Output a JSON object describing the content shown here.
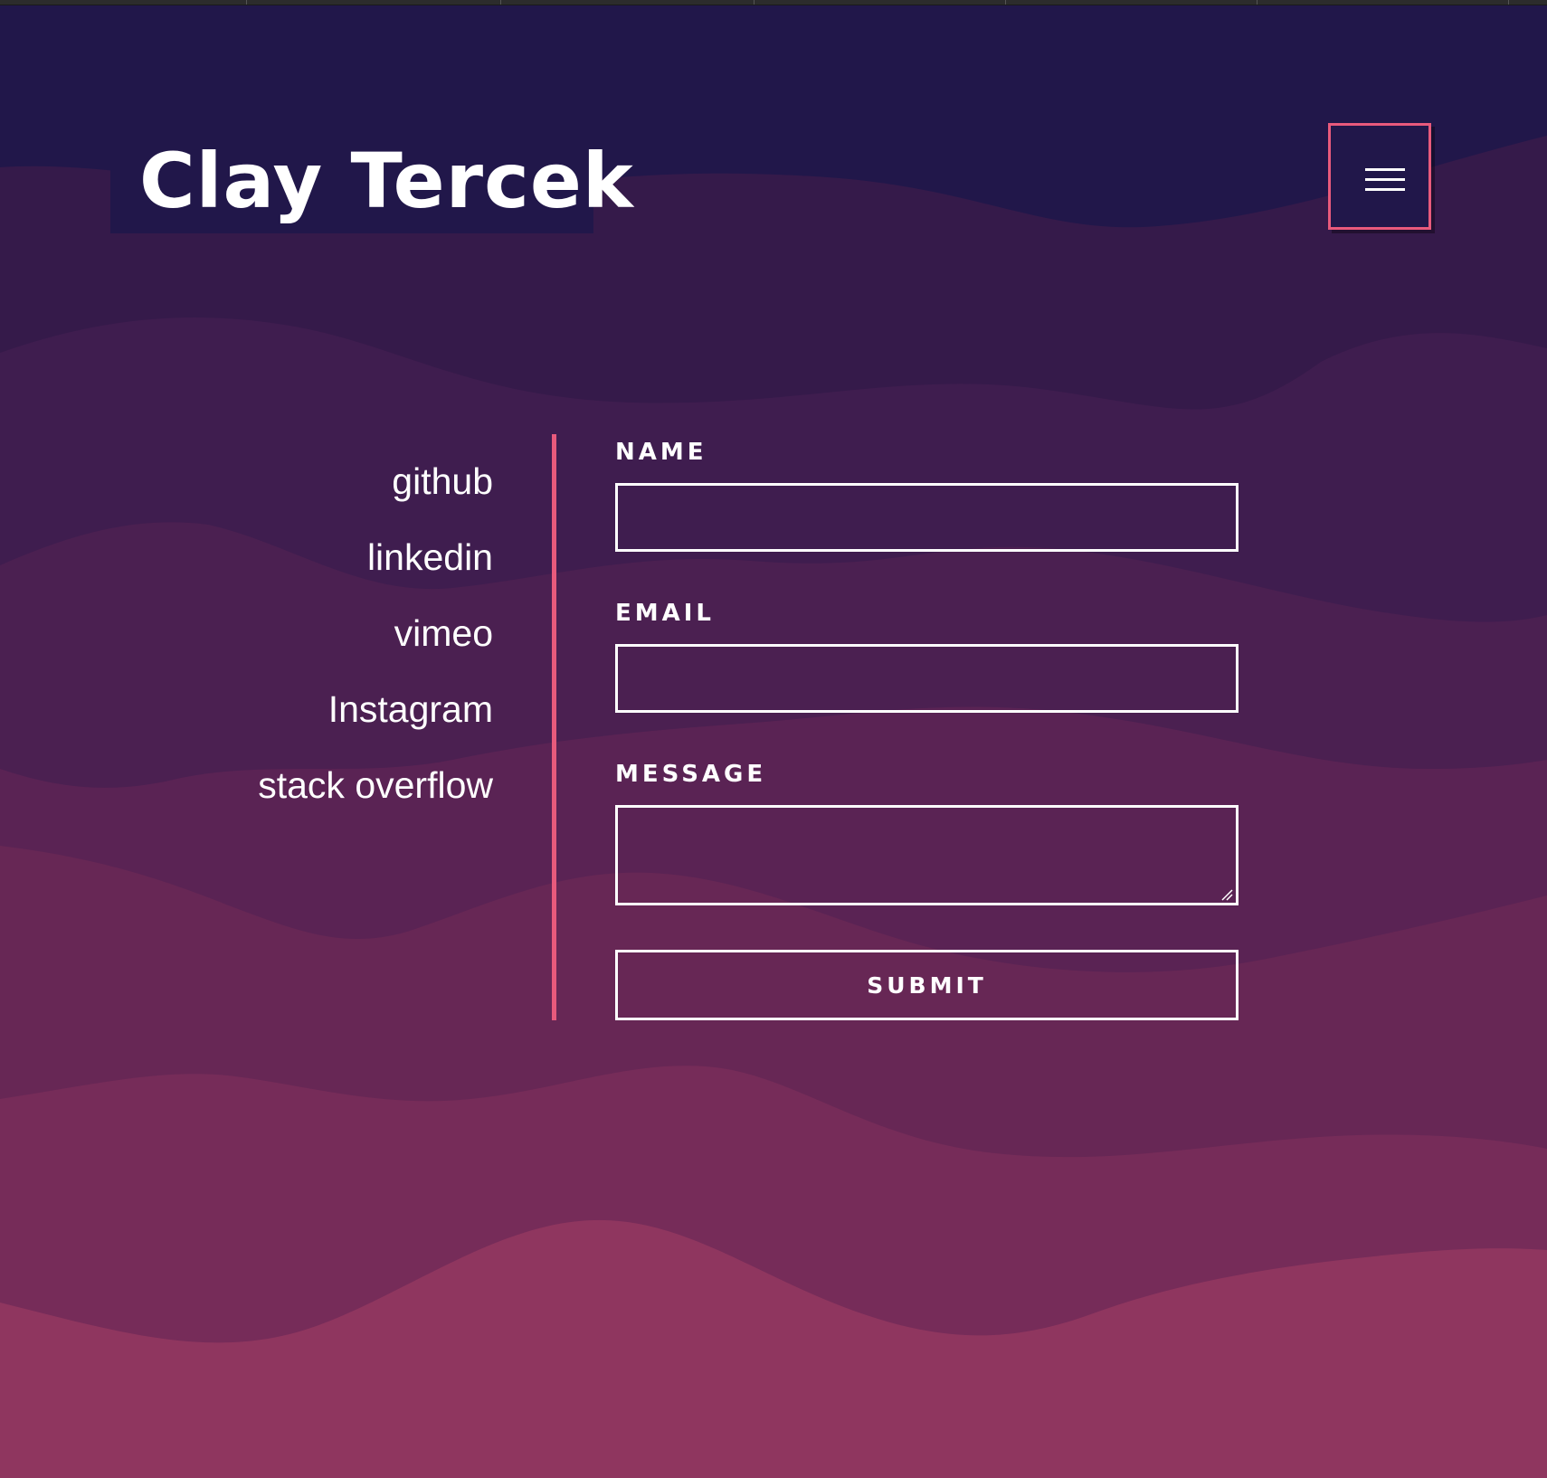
{
  "header": {
    "brand": "Clay Tercek",
    "menu_icon": "hamburger-menu-icon"
  },
  "social": {
    "links": [
      "github",
      "linkedin",
      "vimeo",
      "Instagram",
      "stack overflow"
    ]
  },
  "contact_form": {
    "name_label": "NAME",
    "name_value": "",
    "email_label": "EMAIL",
    "email_value": "",
    "message_label": "MESSAGE",
    "message_value": "",
    "submit_label": "SUBMIT"
  },
  "colors": {
    "background_top": "#21174a",
    "background_bottom": "#8f365f",
    "accent": "#e85a7c",
    "text": "#ffffff"
  }
}
